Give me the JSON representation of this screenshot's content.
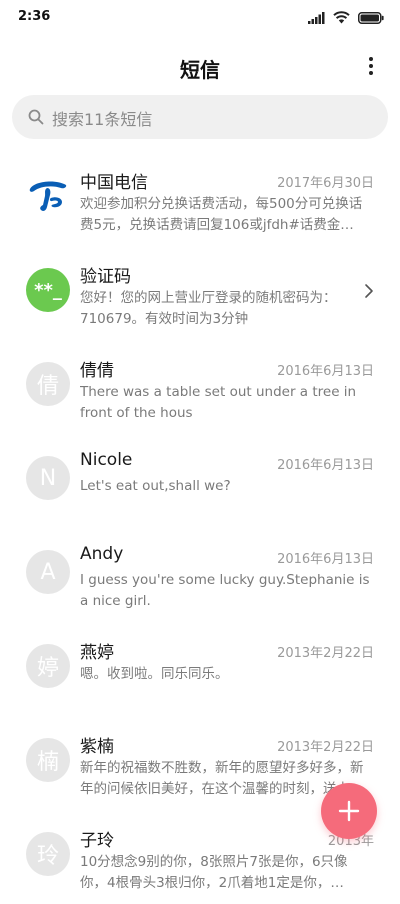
{
  "status_bar": {
    "time": "2:36",
    "icons": [
      "signal-icon",
      "wifi-icon",
      "battery-icon"
    ]
  },
  "header": {
    "title": "短信",
    "more_icon": "more-vertical-icon"
  },
  "search": {
    "placeholder": "搜索11条短信",
    "icon": "search-icon"
  },
  "messages": [
    {
      "sender": "中国电信",
      "date": "2017年6月30日",
      "preview": "欢迎参加积分兑换话费活动，每500分可兑换话费5元，兑换话费请回复106或jfdh#话费金…",
      "avatar_icon": "china-telecom-logo-icon"
    },
    {
      "sender": "验证码",
      "date": "",
      "preview": "您好！您的网上营业厅登录的随机密码为：710679。有效时间为3分钟",
      "avatar_text": "**_",
      "chevron_icon": "chevron-right-icon"
    },
    {
      "sender": "倩倩",
      "date": "2016年6月13日",
      "preview": "There was a table set out under a tree in front of the hous",
      "avatar_text": "倩"
    },
    {
      "sender": "Nicole",
      "date": "2016年6月13日",
      "preview": "Let's eat out,shall we?",
      "avatar_text": "N"
    },
    {
      "sender": "Andy",
      "date": "2016年6月13日",
      "preview": "I guess you're some lucky guy.Stephanie is a nice girl.",
      "avatar_text": "A"
    },
    {
      "sender": "燕婷",
      "date": "2013年2月22日",
      "preview": "嗯。收到啦。同乐同乐。",
      "avatar_text": "婷"
    },
    {
      "sender": "紫楠",
      "date": "2013年2月22日",
      "preview": "新年的祝福数不胜数，新年的愿望好多好多，新年的问候依旧美好，在这个温馨的时刻，送上…",
      "avatar_text": "楠"
    },
    {
      "sender": "子玲",
      "date": "2013年",
      "preview": "10分想念9别的你，8张照片7张是你，6只像你，4根骨头3根归你，2爪着地1定是你，…",
      "avatar_text": "玲"
    }
  ],
  "fab": {
    "icon": "plus-icon"
  },
  "colors": {
    "accent": "#f56b7b",
    "verify_avatar": "#6bc94f",
    "telecom_blue": "#0a5eb5",
    "avatar_gray": "#e6e6e6",
    "search_bg": "#f0f0f0"
  }
}
